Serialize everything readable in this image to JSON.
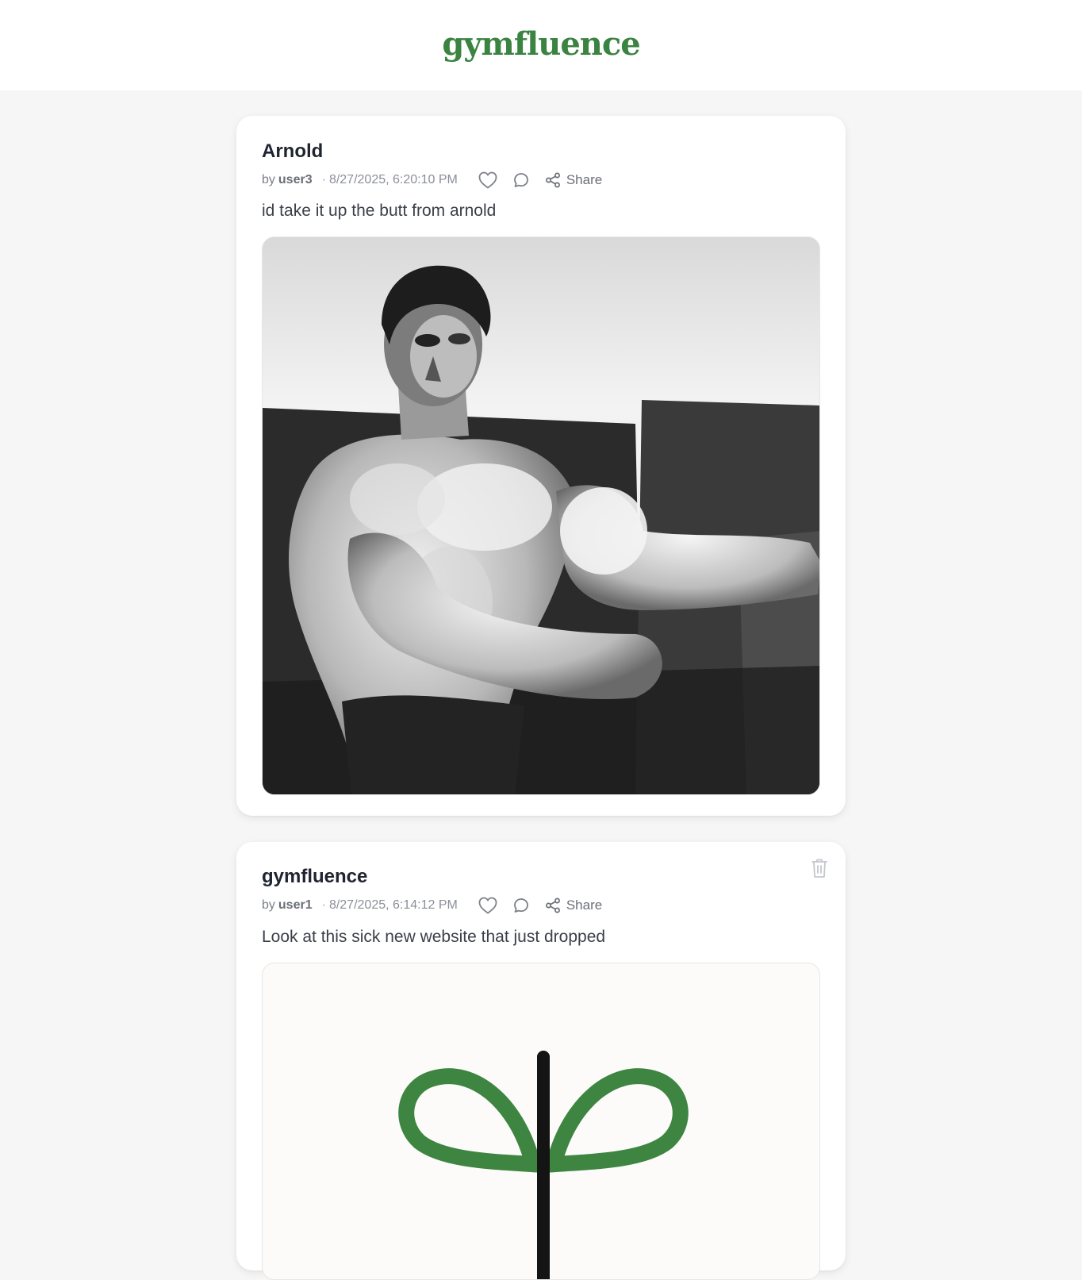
{
  "header": {
    "brand": "gymfluence"
  },
  "posts": [
    {
      "title": "Arnold",
      "by_label": "by",
      "author": "user3",
      "separator": "·",
      "timestamp": "8/27/2025, 6:20:10 PM",
      "body": "id take it up the butt from arnold",
      "share_label": "Share",
      "image": "black-and-white bodybuilder photo"
    },
    {
      "title": "gymfluence",
      "by_label": "by",
      "author": "user1",
      "separator": "·",
      "timestamp": "8/27/2025, 6:14:12 PM",
      "body": "Look at this sick new website that just dropped",
      "share_label": "Share",
      "image": "gymfluence sprout logo",
      "has_delete": true
    }
  ],
  "colors": {
    "brand": "#3a8341",
    "background": "#f6f6f6",
    "card": "#ffffff",
    "muted_text": "#7b7f88"
  },
  "icons": [
    "heart-icon",
    "comment-icon",
    "share-icon",
    "trash-icon"
  ]
}
